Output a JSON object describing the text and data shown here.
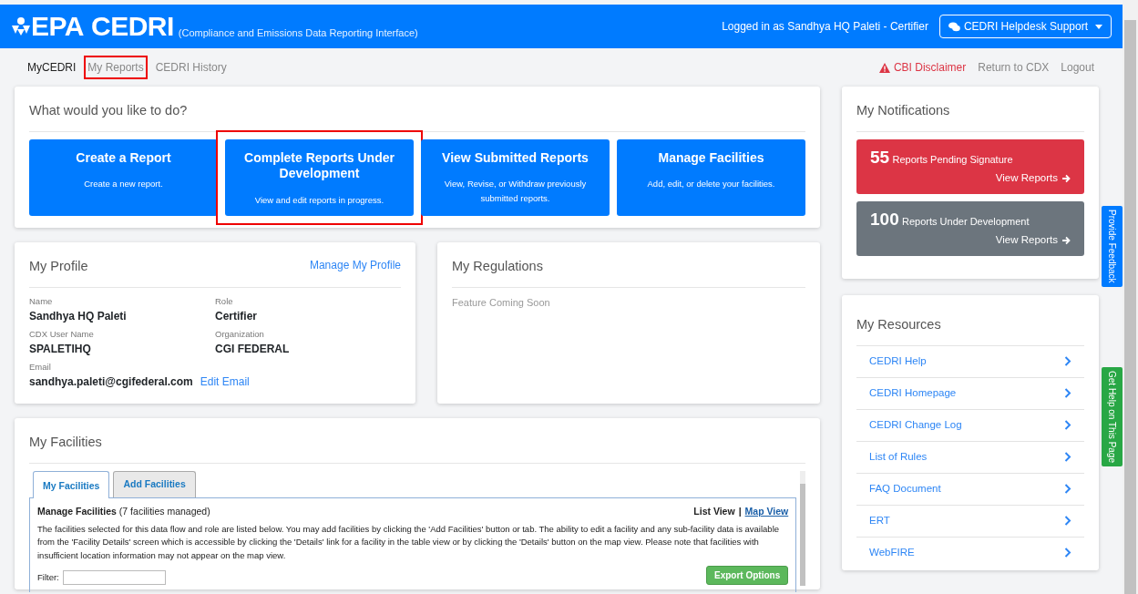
{
  "header": {
    "logo": "EPA",
    "title": "CEDRI",
    "subtitle": "(Compliance and Emissions Data Reporting Interface)",
    "user": "Logged in as Sandhya HQ Paleti - Certifier",
    "helpdesk": "CEDRI Helpdesk Support"
  },
  "nav": {
    "items": [
      {
        "label": "MyCEDRI",
        "selected": true,
        "highlighted": false
      },
      {
        "label": "My Reports",
        "selected": false,
        "highlighted": true
      },
      {
        "label": "CEDRI History",
        "selected": false,
        "highlighted": false
      }
    ],
    "right": [
      {
        "label": "CBI Disclaimer",
        "kind": "warning"
      },
      {
        "label": "Return to CDX",
        "kind": "link"
      },
      {
        "label": "Logout",
        "kind": "link"
      }
    ]
  },
  "actions": {
    "title": "What would you like to do?",
    "buttons": [
      {
        "title": "Create a Report",
        "description": "Create a new report.",
        "highlighted": false
      },
      {
        "title": "Complete Reports Under Development",
        "description": "View and edit reports in progress.",
        "highlighted": true
      },
      {
        "title": "View Submitted Reports",
        "description": "View, Revise, or Withdraw previously submitted reports.",
        "highlighted": false
      },
      {
        "title": "Manage Facilities",
        "description": "Add, edit, or delete your facilities.",
        "highlighted": false
      }
    ]
  },
  "profile": {
    "title": "My Profile",
    "link": "Manage My Profile",
    "fields": [
      {
        "label": "Name",
        "value": "Sandhya HQ Paleti"
      },
      {
        "label": "Role",
        "value": "Certifier"
      },
      {
        "label": "CDX User Name",
        "value": "SPALETIHQ"
      },
      {
        "label": "Organization",
        "value": "CGI FEDERAL"
      }
    ],
    "email_label": "Email",
    "email": "sandhya.paleti@cgifederal.com",
    "edit_link": "Edit Email"
  },
  "regulations": {
    "title": "My Regulations",
    "message": "Feature Coming Soon"
  },
  "facilities": {
    "title": "My Facilities",
    "tabs": [
      {
        "label": "My Facilities",
        "selected": true
      },
      {
        "label": "Add Facilities",
        "selected": false
      }
    ],
    "heading": "Manage Facilities",
    "count": "(7 facilities managed)",
    "separator": "|",
    "views": [
      {
        "label": "List View",
        "selected": true
      },
      {
        "label": "Map View",
        "selected": false
      }
    ],
    "description": "The facilities selected for this data flow and role are listed below. You may add facilities by clicking the 'Add Facilities' button or tab. The ability to edit a facility and any sub-facility data is available from the 'Facility Details' screen which is accessible by clicking the 'Details' link for a facility in the table view or by clicking the 'Details' button on the map view. Please note that facilities with insufficient location information may not appear on the map view.",
    "filter_label": "Filter:",
    "export": "Export Options"
  },
  "notifications": {
    "title": "My Notifications",
    "items": [
      {
        "count": "55",
        "label": "Reports Pending Signature",
        "link": "View Reports",
        "color": "#dc3545"
      },
      {
        "count": "100",
        "label": "Reports Under Development",
        "link": "View Reports",
        "color": "#6c757d"
      }
    ]
  },
  "resources": {
    "title": "My Resources",
    "items": [
      "CEDRI Help",
      "CEDRI Homepage",
      "CEDRI Change Log",
      "List of Rules",
      "FAQ Document",
      "ERT",
      "WebFIRE"
    ]
  },
  "side_tabs": [
    {
      "label": "Provide Feedback",
      "color": "#007bff"
    },
    {
      "label": "Get Help on This Page",
      "color": "#28a745"
    }
  ]
}
